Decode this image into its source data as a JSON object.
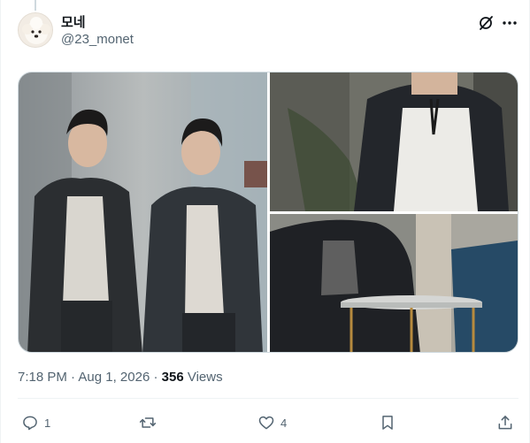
{
  "author": {
    "display_name": "모네",
    "handle": "@23_monet",
    "avatar": "poodle-avatar"
  },
  "header_icons": [
    "grok-icon",
    "more-icon"
  ],
  "media": [
    {
      "alt": "two men in black jackets posing"
    },
    {
      "alt": "man in white tank top and dark hoodie"
    },
    {
      "alt": "man seated beside a marble side table"
    }
  ],
  "meta": {
    "time": "7:18 PM",
    "separator": "·",
    "date": "Aug 1, 2026",
    "views_count": "356",
    "views_label": "Views"
  },
  "actions": {
    "reply_count": "1",
    "repost_count": "",
    "like_count": "4",
    "icons": [
      "reply-icon",
      "repost-icon",
      "like-icon",
      "bookmark-icon",
      "share-icon"
    ]
  },
  "colors": {
    "text_primary": "#0f1419",
    "text_secondary": "#536471",
    "border": "#cfd9de",
    "divider": "#eff3f4"
  }
}
